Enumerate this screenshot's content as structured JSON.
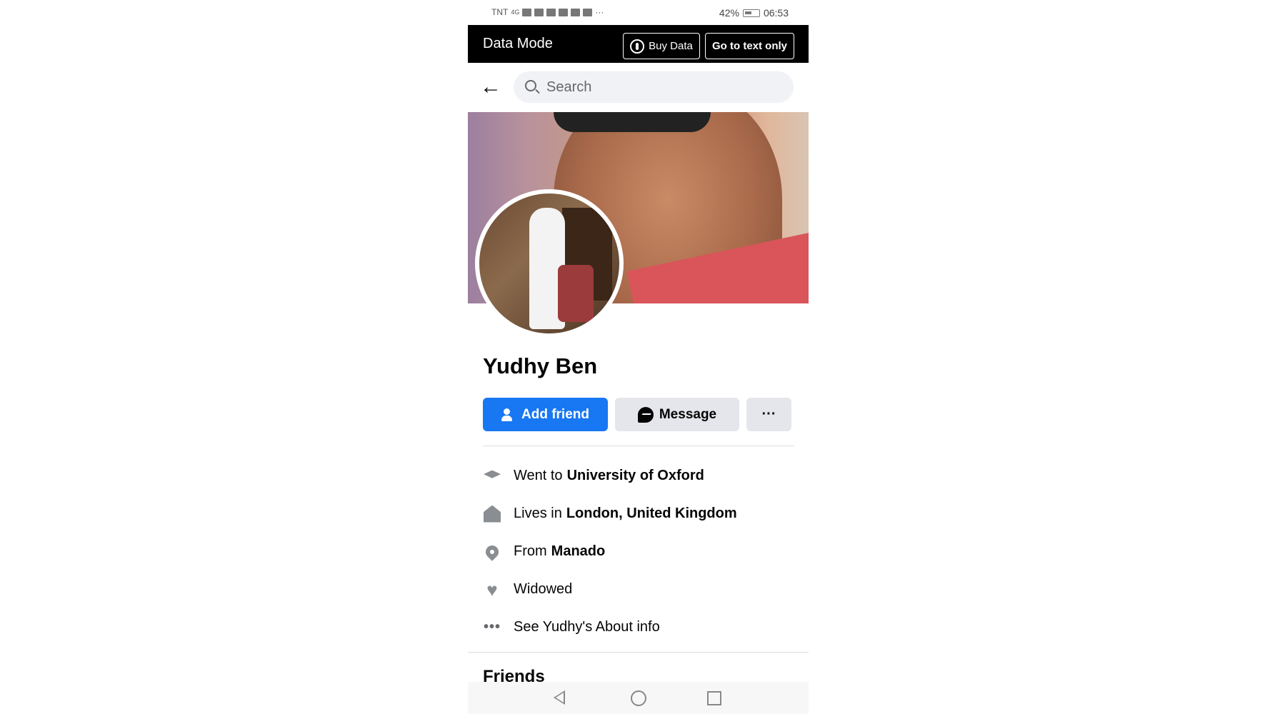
{
  "status_bar": {
    "carrier": "TNT",
    "network": "4G",
    "battery": "42%",
    "time": "06:53",
    "more": "···"
  },
  "data_mode": {
    "title": "Data Mode",
    "buy_data_label": "Buy Data",
    "text_only_label": "Go to text only"
  },
  "search": {
    "placeholder": "Search"
  },
  "profile": {
    "name": "Yudhy Ben",
    "add_friend_label": "Add friend",
    "message_label": "Message",
    "more_label": "···"
  },
  "details": {
    "education_prefix": "Went to",
    "education_value": "University of Oxford",
    "lives_prefix": "Lives in",
    "lives_value": "London, United Kingdom",
    "from_prefix": "From",
    "from_value": "Manado",
    "relationship": "Widowed",
    "about_link": "See Yudhy's About info"
  },
  "sections": {
    "friends_title": "Friends"
  },
  "colors": {
    "accent": "#1877f2",
    "secondary_button": "#e4e6eb",
    "data_bar": "#000000",
    "icon_gray": "#8a8d91"
  },
  "icons": {
    "back": "arrow-left-icon",
    "search": "search-icon",
    "buy_data": "antenna-icon",
    "add_friend": "add-person-icon",
    "message": "messenger-icon",
    "education": "graduation-cap-icon",
    "home": "home-icon",
    "from": "location-pin-icon",
    "relationship": "heart-icon",
    "about": "dots-icon"
  }
}
